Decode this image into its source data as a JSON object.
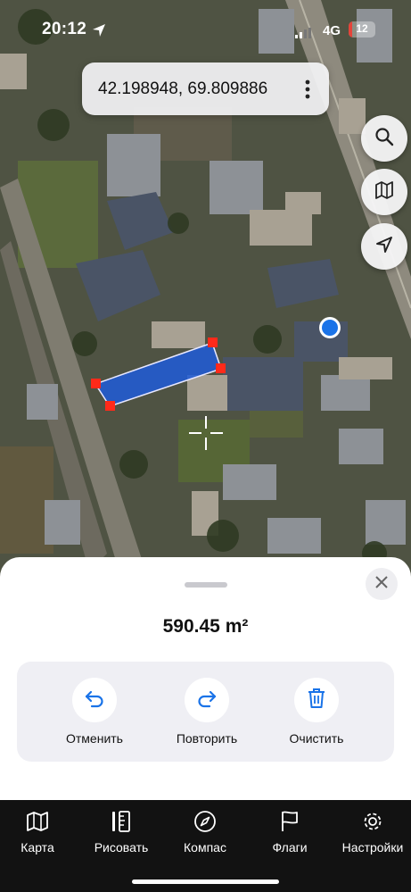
{
  "status_bar": {
    "time": "20:12",
    "network": "4G",
    "battery": "12",
    "battery_level": 0.12,
    "battery_color": "#e5443a"
  },
  "coordinates": "42.198948, 69.809886",
  "measurement": {
    "area": "590.45 m²",
    "polygon_color": "#1e5cd8",
    "vertex_color": "#ff2a1a",
    "user_location_color": "#1a73e8"
  },
  "map_controls": {
    "search_icon": "search-icon",
    "layers_icon": "map-icon",
    "locate_icon": "navigation-arrow-icon"
  },
  "actions": [
    {
      "label": "Отменить",
      "icon": "undo-icon"
    },
    {
      "label": "Повторить",
      "icon": "redo-icon"
    },
    {
      "label": "Очистить",
      "icon": "trash-icon"
    }
  ],
  "tabs": [
    {
      "label": "Карта",
      "icon": "map-icon"
    },
    {
      "label": "Рисовать",
      "icon": "ruler-icon"
    },
    {
      "label": "Компас",
      "icon": "compass-icon"
    },
    {
      "label": "Флаги",
      "icon": "flag-icon"
    },
    {
      "label": "Настройки",
      "icon": "gear-icon"
    }
  ],
  "accent_color": "#1a73e8"
}
